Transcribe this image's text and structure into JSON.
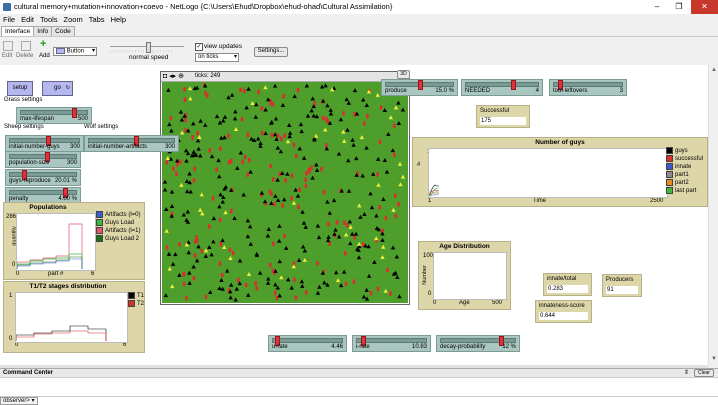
{
  "window": {
    "title": "cultural memory+mutation+innovation+coevo - NetLogo {C:\\Users\\Ehud\\Dropbox\\ehud-ohad\\Cultural Assimilation}",
    "min": "–",
    "max": "❐",
    "close": "✕"
  },
  "menu": [
    "File",
    "Edit",
    "Tools",
    "Zoom",
    "Tabs",
    "Help"
  ],
  "tabs": [
    "Interface",
    "Info",
    "Code"
  ],
  "toolbar": {
    "edit": "Edit",
    "delete": "Delete",
    "add": "Add",
    "widget_type": "Button",
    "speed_label": "normal speed",
    "view_updates": "view updates",
    "update_mode": "on ticks",
    "settings": "Settings..."
  },
  "view": {
    "ticks_label": "ticks: 249",
    "three_d": "3D"
  },
  "buttons": {
    "setup": "setup",
    "go": "go"
  },
  "notes": {
    "grass": "Grass settings",
    "sheep": "Sheep settings",
    "wolf": "Wolf settings"
  },
  "sliders": [
    {
      "name": "max-lifespan",
      "value": "500",
      "frac": 0.82
    },
    {
      "name": "initial-number-guys",
      "value": "300",
      "frac": 0.55
    },
    {
      "name": "initial-number-artifacts",
      "value": "300",
      "frac": 0.55
    },
    {
      "name": "population-size",
      "value": "300",
      "frac": 0.56
    },
    {
      "name": "guys-reproduce",
      "value": "20.01 %",
      "frac": 0.2
    },
    {
      "name": "penalty",
      "value": "4.00 %",
      "frac": 0.85
    },
    {
      "name": "produce",
      "value": "15.0 %",
      "frac": 0.5
    },
    {
      "name": "NEEDED",
      "value": "4",
      "frac": 0.65
    },
    {
      "name": "tool-leftovers",
      "value": "3",
      "frac": 0.08
    },
    {
      "name": "u-rate",
      "value": "4.46",
      "frac": 0.05
    },
    {
      "name": "i-rate",
      "value": "10.83",
      "frac": 0.08
    },
    {
      "name": "decay-probability",
      "value": "12 %",
      "frac": 0.82
    }
  ],
  "monitors": [
    {
      "name": "Successful",
      "value": "175"
    },
    {
      "name": "innate/total",
      "value": "0.283"
    },
    {
      "name": "Producers",
      "value": "91"
    },
    {
      "name": "innateness-score",
      "value": "0.644"
    }
  ],
  "colors": {
    "black": "#000000",
    "red": "#d8312c",
    "blue": "#3b5bd1",
    "gray": "#8c8c8c",
    "orange": "#e58a1f",
    "green": "#3cb83c",
    "pink": "#e0566e",
    "green_dark": "#157315",
    "yellow": "#eded3c",
    "grass": "#4d9e2b"
  },
  "plots": {
    "guys": {
      "title": "Number of guys",
      "ymax": "1000",
      "ymin": "0",
      "xmin": "1",
      "xmax": "2500",
      "xlabel": "Time",
      "ylabel": "#",
      "legend": [
        {
          "name": "guys",
          "color": "black"
        },
        {
          "name": "successful",
          "color": "red"
        },
        {
          "name": "innate",
          "color": "blue"
        },
        {
          "name": "part1",
          "color": "gray"
        },
        {
          "name": "part2",
          "color": "orange"
        },
        {
          "name": "last part",
          "color": "green"
        }
      ]
    },
    "populations": {
      "title": "Populations",
      "ymax": "286",
      "ymin": "0",
      "xmin": "0",
      "xmax": "6",
      "xlabel": "part #",
      "ylabel": "quantity",
      "legend": [
        {
          "name": "Artifacts (l=0)",
          "color": "blue"
        },
        {
          "name": "Guys Load",
          "color": "green"
        },
        {
          "name": "Artifacts (l=1)",
          "color": "pink"
        },
        {
          "name": "Guys Load 2",
          "color": "green_dark"
        }
      ]
    },
    "t1t2": {
      "title": "T1/T2 stages distribution",
      "ymax": "1",
      "ymin": "0",
      "xmin": "0",
      "xmax": "6",
      "legend": [
        {
          "name": "T1",
          "color": "black"
        },
        {
          "name": "T2",
          "color": "red"
        }
      ]
    },
    "age": {
      "title": "Age Distribution",
      "ymax": "100",
      "ymin": "0",
      "xmin": "0",
      "xmax": "500",
      "xlabel": "Age",
      "ylabel": "Number"
    }
  },
  "command_center": {
    "title": "Command Center",
    "clear": "Clear",
    "observer": "observer>"
  }
}
